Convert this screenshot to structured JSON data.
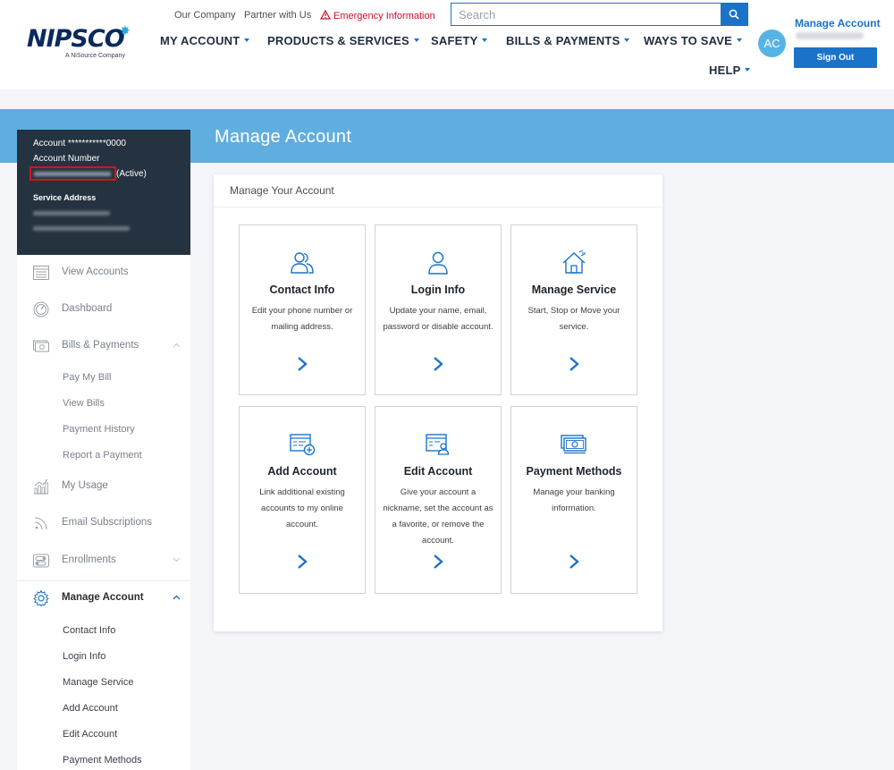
{
  "header": {
    "logo_text": "NIPSCO",
    "logo_sub": "A NiSource Company",
    "util_links": [
      "Our Company",
      "Partner with Us"
    ],
    "emergency": "Emergency Information",
    "search_placeholder": "Search",
    "nav": [
      "MY ACCOUNT",
      "PRODUCTS & SERVICES",
      "SAFETY",
      "BILLS & PAYMENTS",
      "WAYS TO SAVE",
      "HELP"
    ],
    "avatar_initials": "AC",
    "manage_account_link": "Manage Account",
    "sign_out": "Sign Out"
  },
  "banner": {
    "title": "Manage Account"
  },
  "account": {
    "account_line": "Account ***********0000",
    "number_label": "Account Number",
    "status": "(Active)",
    "service_address_label": "Service Address"
  },
  "sidebar": {
    "items": [
      {
        "label": "View Accounts",
        "icon": "list-icon"
      },
      {
        "label": "Dashboard",
        "icon": "gauge-icon"
      },
      {
        "label": "Bills & Payments",
        "icon": "bill-icon",
        "expanded": true
      },
      {
        "label": "My Usage",
        "icon": "chart-icon"
      },
      {
        "label": "Email Subscriptions",
        "icon": "rss-icon"
      },
      {
        "label": "Enrollments",
        "icon": "toggle-icon",
        "expanded": false
      },
      {
        "label": "Manage Account",
        "icon": "gear-icon",
        "expanded": true,
        "active": true
      }
    ],
    "bills_sub": [
      "Pay My Bill",
      "View Bills",
      "Payment History",
      "Report a Payment"
    ],
    "manage_sub": [
      "Contact Info",
      "Login Info",
      "Manage Service",
      "Add Account",
      "Edit Account",
      "Payment Methods"
    ]
  },
  "main": {
    "panel_title": "Manage Your Account",
    "tiles": [
      {
        "title": "Contact Info",
        "desc": "Edit your phone number or mailing address.",
        "icon": "people-icon"
      },
      {
        "title": "Login Info",
        "desc": "Update your name, email, password or disable account.",
        "icon": "user-icon"
      },
      {
        "title": "Manage Service",
        "desc": "Start, Stop or Move your service.",
        "icon": "house-icon"
      },
      {
        "title": "Add Account",
        "desc": "Link additional existing accounts to my online account.",
        "icon": "add-account-icon"
      },
      {
        "title": "Edit Account",
        "desc": "Give your account a nickname, set the account as a favorite, or remove the account.",
        "icon": "edit-account-icon"
      },
      {
        "title": "Payment Methods",
        "desc": "Manage your banking information.",
        "icon": "cash-icon"
      }
    ]
  },
  "colors": {
    "accent": "#1a73c9",
    "banner": "#60aee0",
    "sidebar_dark": "#253340",
    "alert": "#c8102e"
  }
}
